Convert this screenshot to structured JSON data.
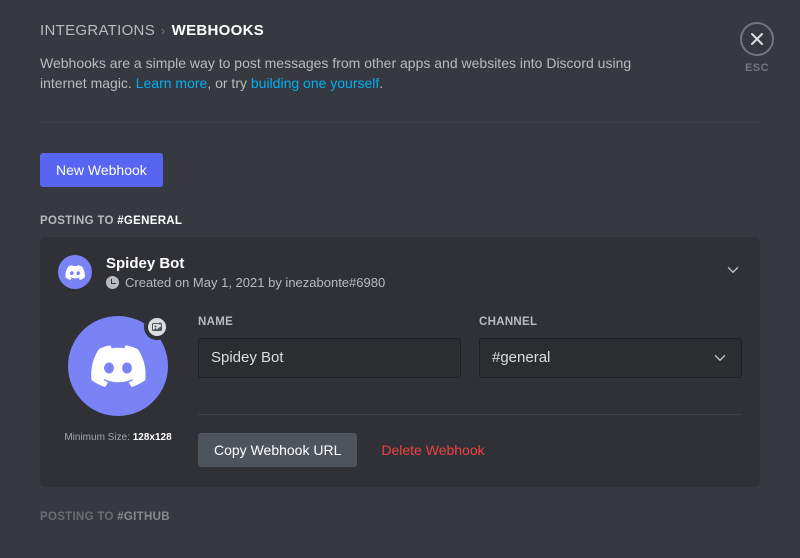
{
  "breadcrumb": {
    "parent": "INTEGRATIONS",
    "current": "WEBHOOKS"
  },
  "description": {
    "prefix": "Webhooks are a simple way to post messages from other apps and websites into Discord using internet magic. ",
    "learn_more": "Learn more",
    "mid": ", or try ",
    "build_link": "building one yourself",
    "suffix": "."
  },
  "buttons": {
    "new_webhook": "New Webhook",
    "copy_url": "Copy Webhook URL",
    "delete": "Delete Webhook"
  },
  "close": {
    "label": "ESC"
  },
  "section": {
    "prefix": "POSTING TO ",
    "channel": "#GENERAL"
  },
  "webhook": {
    "name": "Spidey Bot",
    "created_text": "Created on May 1, 2021 by inezabonte#6980",
    "fields": {
      "name_label": "NAME",
      "name_value": "Spidey Bot",
      "channel_label": "CHANNEL",
      "channel_value": "#general"
    },
    "min_size_prefix": "Minimum Size: ",
    "min_size_value": "128x128"
  },
  "footer": {
    "prefix": "POSTING TO ",
    "channel": "#GITHUB"
  },
  "colors": {
    "accent": "#5865f2",
    "danger": "#ed4245",
    "link": "#00aff4"
  }
}
